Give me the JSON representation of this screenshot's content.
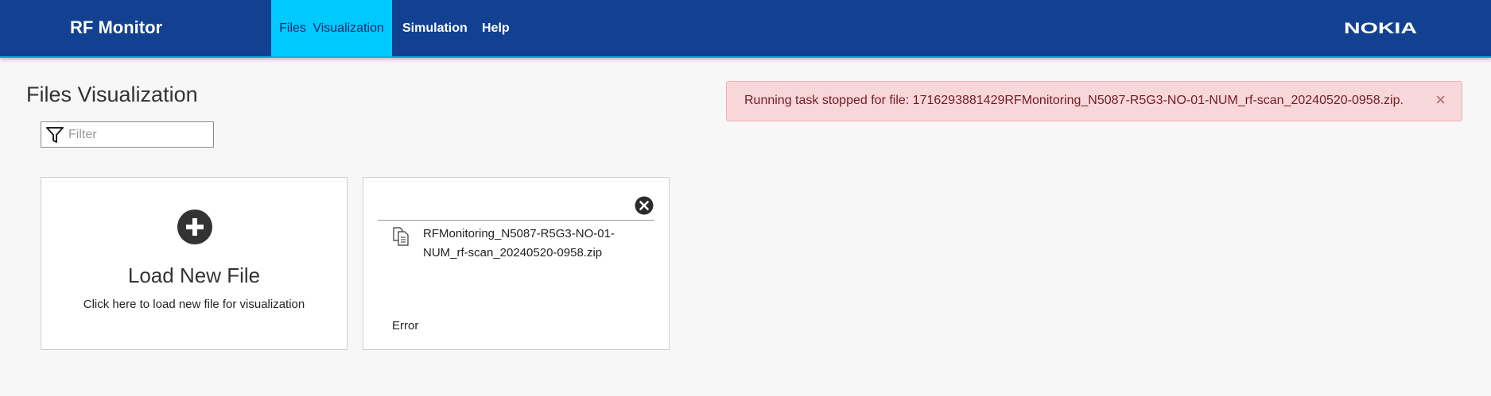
{
  "app": {
    "title": "RF Monitor",
    "logo_text": "NOKIA"
  },
  "nav": {
    "items": [
      {
        "label": "Files  Visualization",
        "active": true
      },
      {
        "label": "Simulation",
        "active": false
      },
      {
        "label": "Help",
        "active": false
      }
    ]
  },
  "page": {
    "title": "Files Visualization"
  },
  "filter": {
    "placeholder": "Filter",
    "value": ""
  },
  "load_card": {
    "title": "Load New File",
    "subtitle": "Click here to load new file for visualization",
    "icon": "plus-circle-icon"
  },
  "file_card": {
    "file_name": "RFMonitoring_N5087-R5G3-NO-01-NUM_rf-scan_20240520-0958.zip",
    "status": "Error",
    "icons": [
      "close-circle-icon",
      "file-copy-icon"
    ]
  },
  "alert": {
    "message": "Running task stopped for file: 1716293881429RFMonitoring_N5087-R5G3-NO-01-NUM_rf-scan_20240520-0958.zip.",
    "close_label": "×"
  },
  "colors": {
    "header_bg": "#124191",
    "active_tab_bg": "#00c9ff",
    "alert_bg": "#f8d7da",
    "alert_text": "#721c24"
  }
}
